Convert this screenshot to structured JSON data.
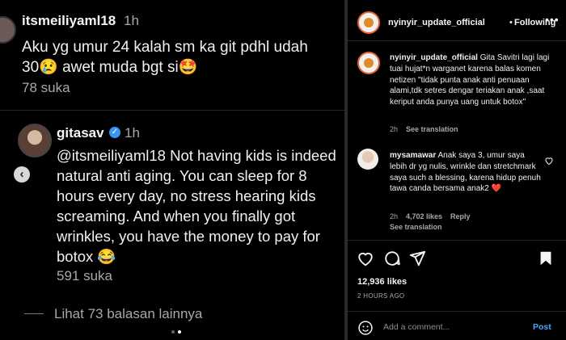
{
  "left": {
    "comment1": {
      "username": "itsmeiliyaml18",
      "time": "1h",
      "text_line1": "Aku yg umur 24 kalah sm ka git pdhl udah",
      "text_line2": "30😢  awet muda bgt si🤩",
      "likes": "78 suka"
    },
    "comment2": {
      "username": "gitasav",
      "time": "1h",
      "text": "@itsmeiliyaml18 Not having kids is indeed natural anti aging. You can sleep for 8 hours every day, no stress hearing kids screaming. And when you finally got wrinkles, you have the money to pay for botox 😂",
      "likes": "591 suka"
    },
    "view_more": "Lihat 73 balasan lainnya"
  },
  "right": {
    "header": {
      "username": "nyinyir_update_official",
      "separator": "•",
      "follow_status": "Following",
      "more": "•••"
    },
    "caption": {
      "username": "nyinyir_update_official",
      "text": " Gita Savitri lagi lagi tuai hujat*n warganet karena balas komen netizen \"tidak punta anak anti penuaan alami,tdk setres dengar teriakan anak ,saat keriput anda punya uang untuk botox\"",
      "time": "2h",
      "see_translation": "See translation"
    },
    "comment": {
      "username": "mysamawar",
      "text": " Anak saya 3, umur saya lebih dr yg nulis, wrinkle dan stretchmark saya such a blessing, karena hidup penuh tawa canda bersama anak2 ❤️",
      "time": "2h",
      "likes": "4,702 likes",
      "reply": "Reply",
      "see_translation": "See translation"
    },
    "likes": "12,936 likes",
    "time_ago": "2 HOURS AGO",
    "add_comment_placeholder": "Add a comment...",
    "post_label": "Post"
  },
  "icons": [
    "chevron-left-icon",
    "verified-icon",
    "heart-icon",
    "comment-icon",
    "share-icon",
    "bookmark-icon",
    "emoji-icon",
    "more-icon"
  ],
  "colors": {
    "background": "#000000",
    "muted": "#a8a8a8",
    "link": "#4da3f5",
    "verified": "#3897f0",
    "heart": "#e0245e"
  }
}
